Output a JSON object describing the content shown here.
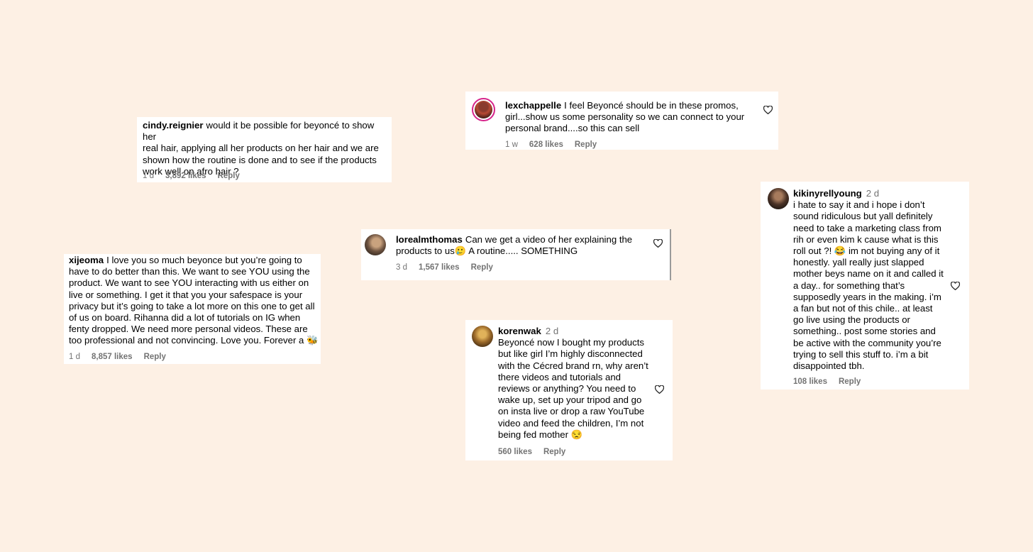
{
  "comments": {
    "cindy": {
      "username": "cindy.reignier",
      "text": "would it be possible for beyoncé to show her\nreal hair, applying all her products on her hair and we are\nshown how the routine is done and to see if the products\nwork well on afro hair ?",
      "age": "1 d",
      "likes": "3,892 likes",
      "reply": "Reply"
    },
    "lex": {
      "username": "lexchappelle",
      "text": "I feel Beyoncé should be in these promos,\ngirl...show us some personality so we can connect to your\npersonal brand....so this can sell",
      "age": "1 w",
      "likes": "628 likes",
      "reply": "Reply"
    },
    "loreal": {
      "username": "lorealmthomas",
      "text": "Can we get a video of her explaining the\nproducts to us🥲 A routine..... SOMETHING",
      "age": "3 d",
      "likes": "1,567 likes",
      "reply": "Reply"
    },
    "xijeoma": {
      "username": "xijeoma",
      "text": "I love you so much beyonce but you’re going to\nhave to do better than this. We want to see YOU using the\nproduct. We want to see YOU interacting with us either on\nlive or something. I get it that you your safespace is your\nprivacy but it’s going to take a lot more on this one to get all\nof us on board. Rihanna did a lot of tutorials on IG when\nfenty dropped. We need more personal videos. These are\ntoo professional and not convincing. Love you. Forever a 🐝",
      "age": "1 d",
      "likes": "8,857 likes",
      "reply": "Reply"
    },
    "koren": {
      "username": "korenwak",
      "age_inline": "2 d",
      "text": "Beyoncé now I bought my products\nbut like girl I’m highly disconnected\nwith the Cécred brand rn, why aren’t\nthere videos and tutorials and\nreviews or anything? You need to\nwake up, set up your tripod and go\non insta live or drop a raw YouTube\nvideo and feed the children, I’m not\nbeing fed mother 😒",
      "likes": "560 likes",
      "reply": "Reply"
    },
    "kikiny": {
      "username": "kikinyrellyoung",
      "age_inline": "2 d",
      "text": "i hate to say it and i hope i don’t\nsound ridiculous but yall definitely\nneed to take a marketing class from\nrih or even kim k cause what is this\nroll out ?! 😂 im not buying any of it\nhonestly. yall really just slapped\nmother beys name on it and called it\na day.. for something that’s\nsupposedly years in the making. i’m\na fan but not of this chile.. at least\ngo live using the products or\nsomething.. post some stories and\nbe active with the community you’re\ntrying to sell this stuff to. i’m a bit\ndisappointed tbh.",
      "likes": "108 likes",
      "reply": "Reply"
    }
  }
}
